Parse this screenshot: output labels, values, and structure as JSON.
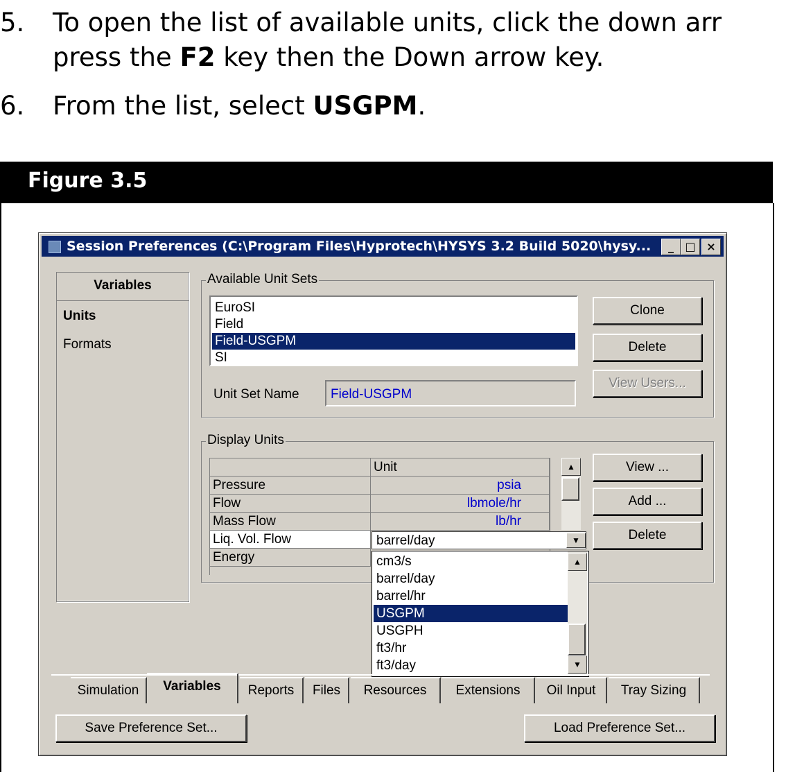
{
  "steps": [
    {
      "num": "5.",
      "line1": "To open the list of available units, click the down arr",
      "line2_pre": "press the ",
      "line2_bold": "F2",
      "line2_post": " key then the Down arrow key."
    },
    {
      "num": "6.",
      "line1_pre": "From the list, select ",
      "line1_bold": "USGPM",
      "line1_post": "."
    }
  ],
  "figure": {
    "label": "Figure 3.5"
  },
  "dialog": {
    "title": "Session Preferences (C:\\Program Files\\Hyprotech\\HYSYS 3.2 Build 5020\\hysy...",
    "caption_buttons": [
      "_",
      "□",
      "×"
    ],
    "variables_header": "Variables",
    "variables_items": [
      {
        "label": "Units",
        "selected": true
      },
      {
        "label": "Formats",
        "selected": false
      }
    ],
    "available_unit_sets": {
      "label": "Available Unit Sets",
      "items": [
        "EuroSI",
        "Field",
        "Field-USGPM",
        "SI"
      ],
      "selected": "Field-USGPM",
      "buttons": {
        "clone": "Clone",
        "delete": "Delete",
        "view_users": "View Users..."
      },
      "unit_set_name_label": "Unit Set Name",
      "unit_set_name_value": "Field-USGPM"
    },
    "display_units": {
      "label": "Display Units",
      "column_header": "Unit",
      "rows": [
        {
          "variable": "Pressure",
          "unit": "psia"
        },
        {
          "variable": "Flow",
          "unit": "lbmole/hr"
        },
        {
          "variable": "Mass Flow",
          "unit": "lb/hr"
        },
        {
          "variable": "Liq. Vol. Flow",
          "unit": "barrel/day"
        },
        {
          "variable": "Energy",
          "unit": ""
        }
      ],
      "buttons": {
        "view": "View ...",
        "add": "Add ...",
        "delete": "Delete"
      },
      "dropdown_options": [
        "cm3/s",
        "barrel/day",
        "barrel/hr",
        "USGPM",
        "USGPH",
        "ft3/hr",
        "ft3/day"
      ],
      "dropdown_highlighted": "USGPM"
    },
    "tabs": [
      {
        "label": "Simulation",
        "active": false
      },
      {
        "label": "Variables",
        "active": true
      },
      {
        "label": "Reports",
        "active": false
      },
      {
        "label": "Files",
        "active": false
      },
      {
        "label": "Resources",
        "active": false
      },
      {
        "label": "Extensions",
        "active": false
      },
      {
        "label": "Oil Input",
        "active": false
      },
      {
        "label": "Tray Sizing",
        "active": false
      }
    ],
    "footer": {
      "save": "Save Preference Set...",
      "load": "Load Preference Set..."
    }
  },
  "colors": {
    "selection": "#0a246a",
    "titlebar": "#0a246a",
    "dialog_face": "#d4d0c8",
    "unit_text": "#0000cc"
  }
}
